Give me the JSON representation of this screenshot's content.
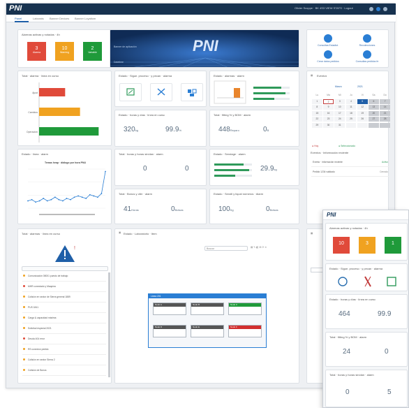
{
  "app": {
    "logo": "PNI",
    "user": "Olivier Scoppe · BK 4S3 VIEW STATS · Logout"
  },
  "tabs": [
    "Panel",
    "Laborats",
    "Banner Devices",
    "Banner Loyaltom"
  ],
  "alarms": {
    "title": "Alarmas activas y notadas · 4h",
    "items": [
      {
        "value": "3",
        "label": "Alarma"
      },
      {
        "value": "10",
        "label": "Warning"
      },
      {
        "value": "2",
        "label": "Variable"
      }
    ]
  },
  "banner": {
    "text": "Banner de aplicación",
    "caption": "Datetime"
  },
  "quick_actions": [
    {
      "label": "Consultas Estadist."
    },
    {
      "label": "Recolecciones"
    },
    {
      "label": "Crear datos pedidos"
    },
    {
      "label": "Consultas pedidos fe"
    }
  ],
  "cards": {
    "bar_chart": "Total · alarma · línea en curso",
    "icons_card": "Estado · Sigue. proceso · y pecan · alarma",
    "stock_card": "Estado · alarmas · alarm",
    "calendar": "Eventos",
    "line_card": "Estado · linea · alarm",
    "line_chart_title": "Temas heap · diálogo por hora PNU",
    "kpi1": "Estado · horas y días · línea en curso",
    "kpi2": "Total · fitting % y BOM · alarm",
    "kpi3": "Total · horas y horas sinólan · alarm",
    "kpi4": "Estado · Sendage · alarm",
    "kpi5": "Total · Bonus y ofer · alarm",
    "kpi6": "Estado · Sendil y liquid números · Alarm",
    "alarm_list": "Total · alarmas · línea en curso",
    "diagram": "Estado · Laboratorio · Item",
    "events_list": "Eventos · Información reciente"
  },
  "chart_data": [
    {
      "type": "bar",
      "categories": [
        "Ajust",
        "Cambios",
        "Operación"
      ],
      "values": [
        7,
        11,
        16
      ],
      "xlabel": "",
      "ylabel": "",
      "title": ""
    },
    {
      "type": "line",
      "title": "Temas heap · diálogo por hora PNU",
      "series": [
        {
          "name": "",
          "values": [
            6,
            7,
            5,
            6,
            8,
            6,
            7,
            9,
            7,
            6,
            8,
            7,
            9,
            10,
            9,
            8,
            11,
            10,
            9,
            12,
            30
          ]
        }
      ]
    }
  ],
  "kpis": [
    {
      "value": "320",
      "unit": "kg",
      "side": "0",
      "sideunit": "B"
    },
    {
      "value": "99.9",
      "unit": "%",
      "side": "448",
      "sideunit": "Reparo"
    },
    {
      "value": "0",
      "unit": "",
      "side": "0",
      "sideunit": ""
    },
    {
      "value": "29.9",
      "unit": "kg",
      "side": "0",
      "sideunit": ""
    },
    {
      "value": "41",
      "unit": "Horas",
      "side": "0",
      "sideunit": "Bolsas"
    },
    {
      "value": "100",
      "unit": "Kg",
      "side": "0",
      "sideunit": "Bolsas"
    }
  ],
  "calendar": {
    "month": "Marzo",
    "year": "2021",
    "days_header": [
      "Lu",
      "Ma",
      "Mi",
      "Ju",
      "Vi",
      "Sa",
      "Do"
    ],
    "days": [
      "1",
      "2",
      "3",
      "4",
      "5",
      "6",
      "7",
      "8",
      "9",
      "10",
      "11",
      "12",
      "13",
      "14",
      "15",
      "16",
      "17",
      "18",
      "19",
      "20",
      "21",
      "22",
      "23",
      "24",
      "25",
      "26",
      "27",
      "28",
      "29",
      "30",
      "31",
      "",
      "",
      "",
      ""
    ]
  },
  "events": [
    {
      "text": "Evento · información reciente",
      "state": "Activo"
    },
    {
      "text": "Pedido 1234 validado",
      "state": "Cerrado"
    }
  ],
  "alarm_rows": [
    "Comunicación 08001 puesto de trabajo",
    "MHR conectado y Maquina",
    "Colisión en sector de Sierra general 1889",
    "PUS 1841",
    "Carga & capacidad máxima",
    "Solicitud especial 2021",
    "Deuda 404 error",
    "RS conexion pedido",
    "Colisión en sector Sierra 2",
    "Colisión de Bonus"
  ],
  "diagram": {
    "title": "Linea 201",
    "search": "Buscar",
    "nodes": [
      {
        "label": "Nodo A"
      },
      {
        "label": "Nodo B"
      },
      {
        "label": "Nodo C"
      },
      {
        "label": "Nodo D"
      },
      {
        "label": "Nodo E"
      },
      {
        "label": "Nodo F"
      }
    ]
  },
  "mobile": {
    "logo": "PNI",
    "alarm_title": "Alarmas activas y notadas · 4h",
    "alarms": [
      {
        "value": "10"
      },
      {
        "value": "3"
      },
      {
        "value": "1"
      }
    ],
    "icons_title": "Estado · Sigue. proceso · y pecan · alarma",
    "kpi_title": "Estado · horas y días · línea en curso",
    "kpi_a": "464",
    "kpi_b": "99.9",
    "bom_title": "Total · fitting % y BOM · alarm",
    "bom_a": "24",
    "bom_b": "0",
    "last_title": "Total · horas y horas sinólan · alarm",
    "last_a": "0",
    "last_b": "5"
  }
}
